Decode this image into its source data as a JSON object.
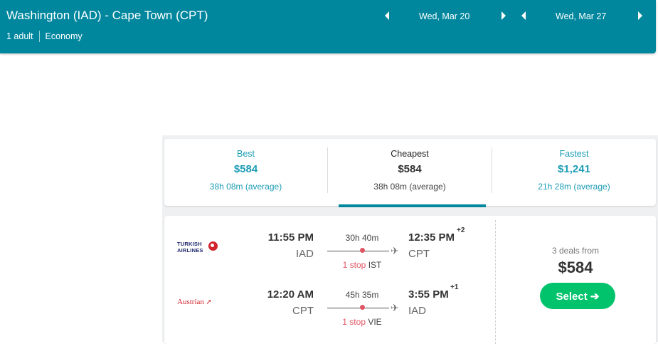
{
  "header": {
    "route": "Washington (IAD) - Cape Town (CPT)",
    "passengers": "1 adult",
    "cabin": "Economy",
    "depart_date": "Wed, Mar 20",
    "return_date": "Wed, Mar 27"
  },
  "sort_tabs": [
    {
      "label": "Best",
      "price": "$584",
      "duration": "38h 08m (average)"
    },
    {
      "label": "Cheapest",
      "price": "$584",
      "duration": "38h 08m (average)",
      "active": true
    },
    {
      "label": "Fastest",
      "price": "$1,241",
      "duration": "21h 28m (average)"
    }
  ],
  "result": {
    "outbound": {
      "airline": "TURKISH AIRLINES",
      "depart_time": "11:55 PM",
      "depart_code": "IAD",
      "duration": "30h 40m",
      "stop_count": "1 stop",
      "stop_airport": "IST",
      "arrive_time": "12:35 PM",
      "day_offset": "+2",
      "arrive_code": "CPT"
    },
    "inbound": {
      "airline": "Austrian",
      "depart_time": "12:20 AM",
      "depart_code": "CPT",
      "duration": "45h 35m",
      "stop_count": "1 stop",
      "stop_airport": "VIE",
      "arrive_time": "3:55 PM",
      "day_offset": "+1",
      "arrive_code": "IAD"
    },
    "deals_text": "3 deals from",
    "price": "$584",
    "select_label": "Select ➔"
  },
  "colors": {
    "header_bg": "#00879e",
    "accent_teal": "#1d9db5",
    "select_green": "#00c36b",
    "stop_red": "#e05563"
  }
}
